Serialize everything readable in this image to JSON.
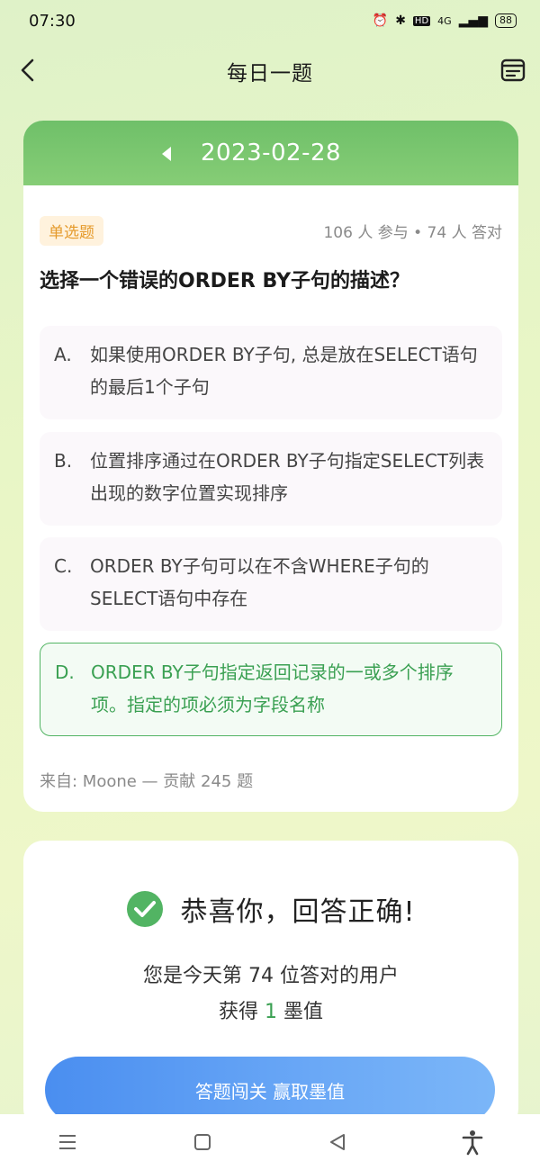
{
  "status": {
    "time": "07:30",
    "network": "4G",
    "hd": "HD",
    "battery": "88"
  },
  "header": {
    "title": "每日一题"
  },
  "question": {
    "date": "2023-02-28",
    "type": "单选题",
    "stats": "106 人 参与 • 74 人 答对",
    "text": "选择一个错误的ORDER BY子句的描述？",
    "options": [
      {
        "letter": "A.",
        "text": "如果使用ORDER BY子句, 总是放在SELECT语句的最后1个子句"
      },
      {
        "letter": "B.",
        "text": "位置排序通过在ORDER BY子句指定SELECT列表出现的数字位置实现排序"
      },
      {
        "letter": "C.",
        "text": "ORDER BY子句可以在不含WHERE子句的SELECT语句中存在"
      },
      {
        "letter": "D.",
        "text": "ORDER BY子句指定返回记录的一或多个排序项。指定的项必须为字段名称",
        "selected": true,
        "correct": true
      }
    ],
    "source": "来自:  Moone   —   贡献 245 题"
  },
  "result": {
    "title": "恭喜你，回答正确!",
    "rank_line": "您是今天第 74 位答对的用户",
    "reward_prefix": "获得 ",
    "reward_value": "1",
    "reward_suffix": " 墨值",
    "button_label": "答题闯关 赢取墨值"
  },
  "colors": {
    "accent_green": "#3aa052",
    "header_green": "#6fc069",
    "button_blue": "#4a8ef0",
    "badge_orange": "#e59a2b"
  },
  "icons": [
    "back-arrow-icon",
    "calendar-icon",
    "prev-date-icon",
    "check-circle-icon",
    "menu-icon",
    "home-icon",
    "back-icon",
    "accessibility-icon"
  ]
}
